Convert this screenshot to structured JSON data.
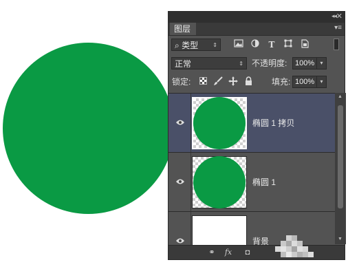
{
  "canvas": {
    "shape_color": "#0a9a44"
  },
  "panel": {
    "collapse_glyph": "◂◂",
    "close_glyph": "✕",
    "tab_label": "图层",
    "panel_menu_glyph": "▾≡",
    "filter": {
      "search_glyph": "⌕",
      "value": "类型",
      "arrow": "⇕"
    },
    "filter_icons": [
      "image-filter-icon",
      "adjustment-filter-icon",
      "type-filter-icon",
      "shape-filter-icon",
      "smart-object-filter-icon"
    ],
    "blend": {
      "value": "正常",
      "arrow": "⇕"
    },
    "opacity": {
      "label": "不透明度:",
      "value": "100%",
      "arrow": "▾"
    },
    "lock": {
      "label": "锁定:"
    },
    "fill": {
      "label": "填充:",
      "value": "100%",
      "arrow": "▾"
    },
    "layers": [
      {
        "name": "椭圆 1 拷贝",
        "selected": true,
        "visible": true
      },
      {
        "name": "椭圆 1",
        "selected": false,
        "visible": true
      },
      {
        "name": "背景",
        "selected": false,
        "visible": true
      }
    ],
    "scroll": {
      "up": "▲",
      "down": "▼"
    },
    "bottom_icons": {
      "link": "⚭",
      "fx": "fx",
      "mask": "◘"
    }
  }
}
